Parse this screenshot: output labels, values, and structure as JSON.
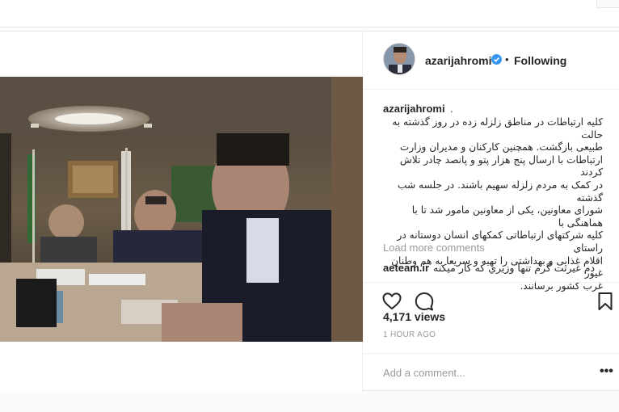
{
  "post": {
    "username": "azarijahromi",
    "follow_status": "Following",
    "bullet": "•",
    "caption_user": "azarijahromi",
    "caption_dot": ".",
    "caption_text": "کلیه ارتباطات در مناطق زلزله زده در روز گذشته به حالت\nطبیعی بازگشت. همچنین کارکنان و مدیران وزارت\nارتباطات با ارسال پنج هزار پتو و پانصد چادر تلاش کردند\nدر کمک به مردم زلزله سهیم باشند. در جلسه شب گذشته\nشورای معاونین، یکی از معاونین مامور شد تا با هماهنگی با\nکلیه شرکتهای ارتباطاتی کمکهای انسان دوستانه در راستای\nاقلام غذایی و بهداشتی را تهیه و سریعا به هم وطنان غیور\nغرب کشور برسانند.",
    "load_more": "Load more comments",
    "comment": {
      "user": "aeteam.ir",
      "text": "دم غیرتت گرم تنها وزیري که کار میکنه"
    },
    "views": "4,171 views",
    "time": "1 HOUR AGO",
    "comment_placeholder": "Add a comment...",
    "more_dots": "•••"
  },
  "icons": {
    "verified": "verified-badge-icon",
    "like": "heart-icon",
    "comment": "comment-bubble-icon",
    "save": "bookmark-icon",
    "more": "more-options-icon"
  },
  "colors": {
    "verified": "#3897f0",
    "muted_text": "#999999",
    "text": "#262626",
    "border": "#efefef"
  }
}
